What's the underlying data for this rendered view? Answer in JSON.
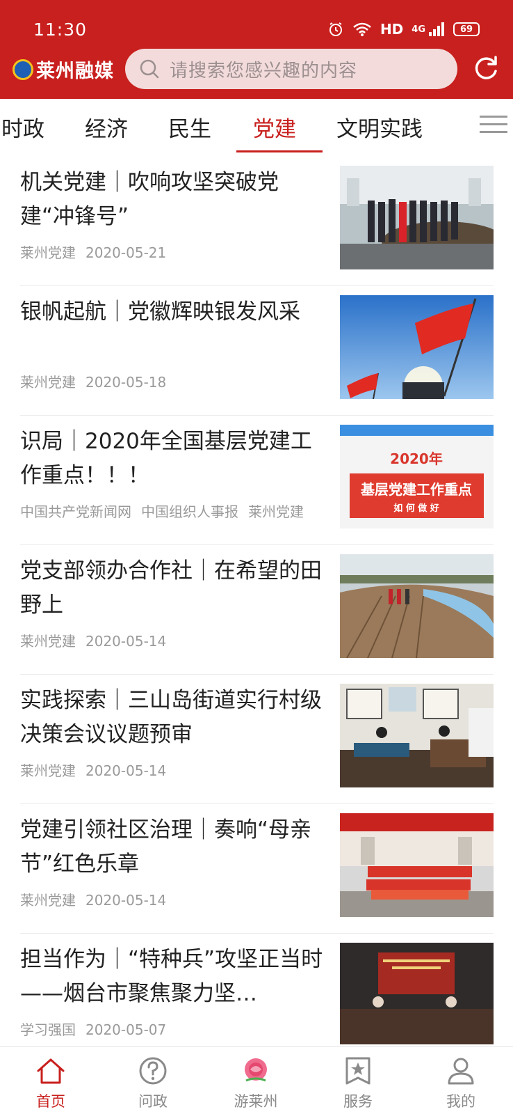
{
  "status": {
    "time": "11:30",
    "hd": "HD",
    "network": "4G",
    "battery": "69"
  },
  "header": {
    "app_name": "莱州融媒",
    "search_placeholder": "请搜索您感兴趣的内容"
  },
  "tabs": [
    {
      "label": "时政",
      "active": false
    },
    {
      "label": "经济",
      "active": false
    },
    {
      "label": "民生",
      "active": false
    },
    {
      "label": "党建",
      "active": true
    },
    {
      "label": "文明实践",
      "active": false
    }
  ],
  "articles": [
    {
      "title": "机关党建｜吹响攻坚突破党建“冲锋号”",
      "source": "莱州党建",
      "date": "2020-05-21"
    },
    {
      "title": "银帆起航｜党徽辉映银发风采",
      "source": "莱州党建",
      "date": "2020-05-18"
    },
    {
      "title": "识局｜2020年全国基层党建工作重点！！！",
      "sources": [
        "中国共产党新闻网",
        "中国组织人事报",
        "莱州党建"
      ],
      "thumb_text": {
        "year": "2020年",
        "headline": "基层党建工作重点",
        "sub": "如 何 做 好"
      }
    },
    {
      "title": "党支部领办合作社｜在希望的田野上",
      "source": "莱州党建",
      "date": "2020-05-14"
    },
    {
      "title": "实践探索｜三山岛街道实行村级决策会议议题预审",
      "source": "莱州党建",
      "date": "2020-05-14"
    },
    {
      "title": "党建引领社区治理｜奏响“母亲节”红色乐章",
      "source": "莱州党建",
      "date": "2020-05-14"
    },
    {
      "title": "担当作为｜“特种兵”攻坚正当时——烟台市聚焦聚力坚…",
      "source": "学习强国",
      "date": "2020-05-07"
    }
  ],
  "bottom_nav": [
    {
      "label": "首页",
      "icon": "home-icon",
      "active": true
    },
    {
      "label": "问政",
      "icon": "question-icon",
      "active": false
    },
    {
      "label": "游莱州",
      "icon": "rose-icon",
      "active": false
    },
    {
      "label": "服务",
      "icon": "bookmark-star-icon",
      "active": false
    },
    {
      "label": "我的",
      "icon": "user-icon",
      "active": false
    }
  ],
  "colors": {
    "brand_red": "#c8201e",
    "text": "#222222",
    "meta": "#9a9a9a"
  }
}
